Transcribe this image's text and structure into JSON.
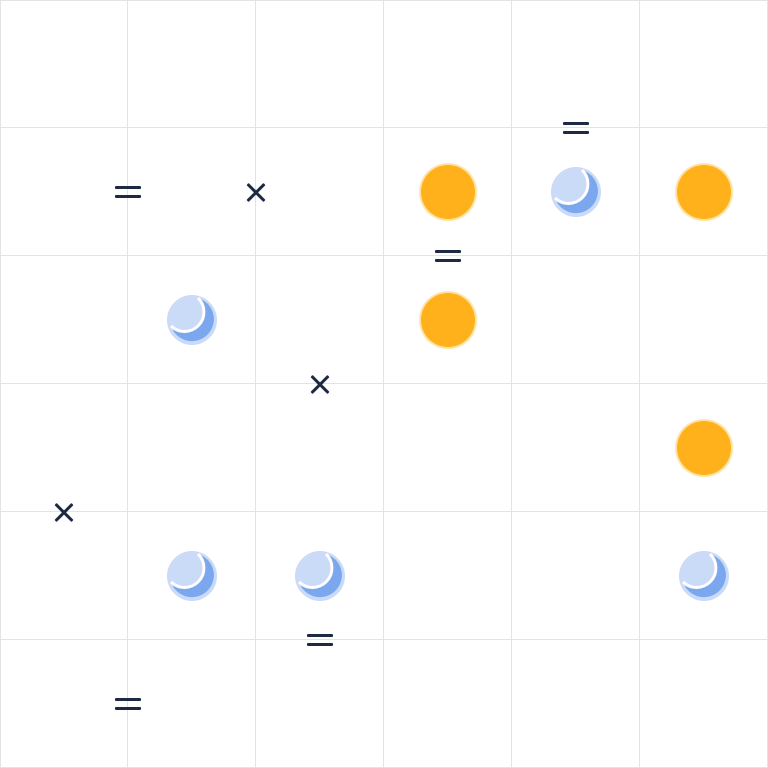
{
  "puzzle": {
    "grid_size": 6,
    "cells": [
      [
        "",
        "",
        "",
        "",
        "",
        ""
      ],
      [
        "",
        "",
        "",
        "sun",
        "moon",
        "sun"
      ],
      [
        "",
        "moon",
        "",
        "sun",
        "",
        ""
      ],
      [
        "",
        "",
        "",
        "",
        "",
        "sun"
      ],
      [
        "",
        "moon",
        "moon",
        "",
        "",
        "moon"
      ],
      [
        "",
        "",
        "",
        "",
        "",
        ""
      ]
    ],
    "constraints": [
      {
        "type": "equal",
        "between": [
          [
            1,
            0
          ],
          [
            1,
            1
          ]
        ]
      },
      {
        "type": "opposite",
        "between": [
          [
            1,
            1
          ],
          [
            1,
            2
          ]
        ]
      },
      {
        "type": "equal",
        "between": [
          [
            0,
            4
          ],
          [
            1,
            4
          ]
        ]
      },
      {
        "type": "equal",
        "between": [
          [
            1,
            3
          ],
          [
            2,
            3
          ]
        ]
      },
      {
        "type": "opposite",
        "between": [
          [
            2,
            2
          ],
          [
            3,
            2
          ]
        ]
      },
      {
        "type": "opposite",
        "between": [
          [
            3,
            0
          ],
          [
            4,
            0
          ]
        ]
      },
      {
        "type": "equal",
        "between": [
          [
            4,
            2
          ],
          [
            5,
            2
          ]
        ]
      },
      {
        "type": "equal",
        "between": [
          [
            5,
            0
          ],
          [
            5,
            1
          ]
        ]
      }
    ],
    "colors": {
      "sun": "#ffb11c",
      "sun_ring": "#fde3a6",
      "moon": "#7aa7ee",
      "moon_ring": "#c9dbf7",
      "grid_line": "#e3e3e3",
      "constraint": "#1e2a44"
    }
  }
}
